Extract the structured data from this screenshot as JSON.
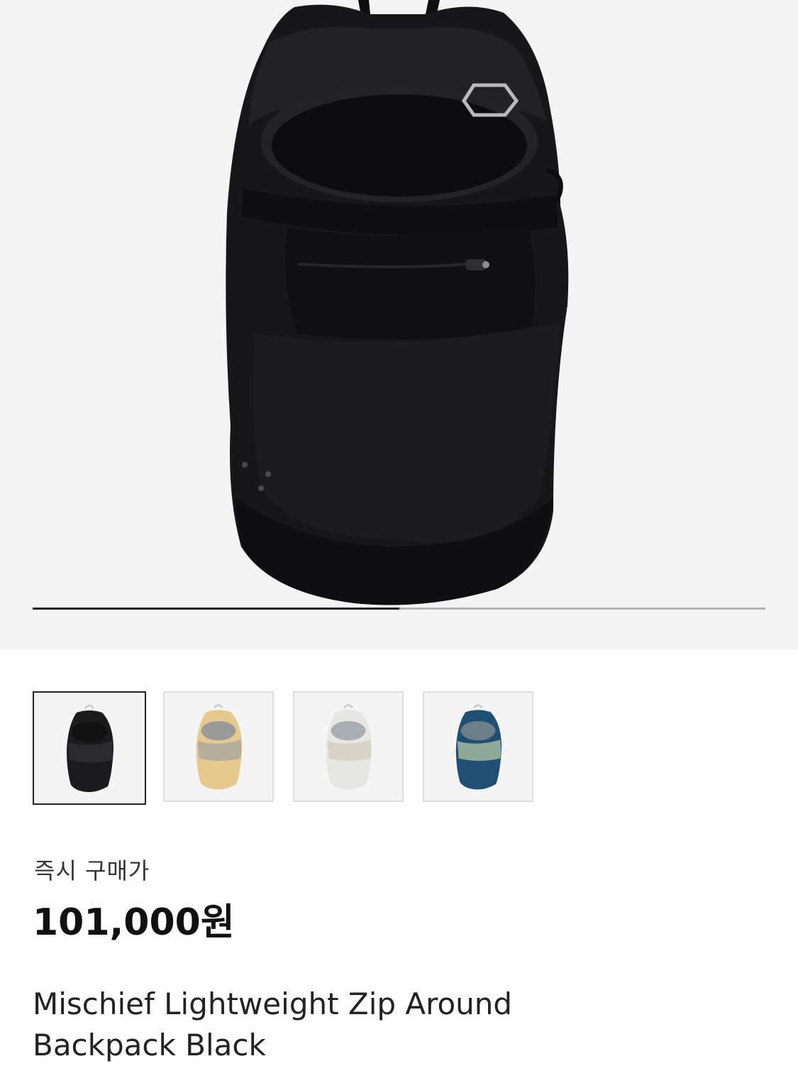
{
  "gallery": {
    "current_slide_fraction": 0.5,
    "thumbnails": [
      {
        "color_name": "black",
        "body": "#1b1b1d",
        "panel": "#2b2b2e",
        "mesh": "#111111",
        "selected": true
      },
      {
        "color_name": "beige",
        "body": "#e6c98c",
        "panel": "#b7ad9d",
        "mesh": "#9a9a98",
        "selected": false
      },
      {
        "color_name": "white",
        "body": "#e6e6e4",
        "panel": "#d8d3c7",
        "mesh": "#a9adb4",
        "selected": false
      },
      {
        "color_name": "blue",
        "body": "#1f4f72",
        "panel": "#8fa999",
        "mesh": "#6d7f89",
        "selected": false
      }
    ]
  },
  "product": {
    "price_label": "즉시 구매가",
    "price": "101,000원",
    "name_line1": "Mischief Lightweight Zip Around",
    "name_line2": "Backpack Black"
  },
  "colors": {
    "hero_background": "#f4f4f4",
    "bag": "#161618",
    "accent_text": "#111111"
  }
}
